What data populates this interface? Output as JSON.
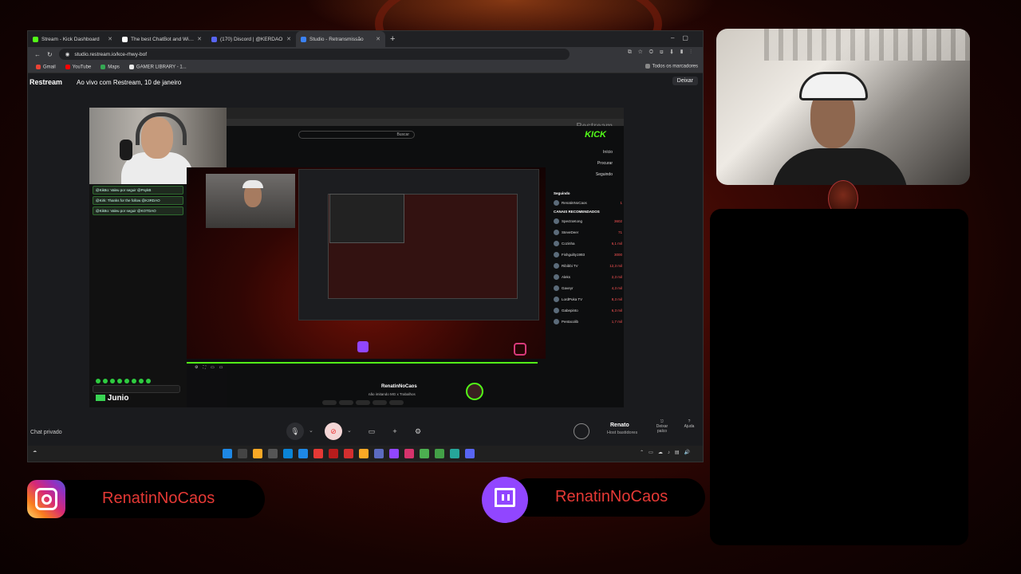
{
  "browser": {
    "tabs": [
      {
        "title": "Stream - Kick Dashboard",
        "color": "#53fc18",
        "active": false
      },
      {
        "title": "The best ChatBot and Widget",
        "color": "#ffffff",
        "active": false
      },
      {
        "title": "(170) Discord | @KERDAO",
        "color": "#5865f2",
        "active": false
      },
      {
        "title": "Studio - Retransmissão",
        "color": "#3b82f6",
        "active": true
      }
    ],
    "url": "studio.restream.io/kce-rhwy-bof",
    "bookmarks": [
      "Gmail",
      "YouTube",
      "Maps",
      "GAMER LIBRARY - 1..."
    ],
    "bookmarks_right": "Todos os marcadores"
  },
  "studio": {
    "logo": "Restream",
    "title": "Ao vivo com Restream, 10 de janeiro",
    "exit_label": "Deixar",
    "chat_private": "Chat privado",
    "user_name": "Renato",
    "user_sub": "Host bastidores",
    "leave_label": "Deixar palco",
    "help_label": "Ajuda"
  },
  "canvas": {
    "chat_lines": [
      "@Kik8o: Valeu por seguir @PsykB",
      "@Kirk: Thanks for the follow @K3RDAO",
      "@Kik8o: Valeu por seguir @KOTDAO"
    ],
    "chat_name": "Junio",
    "kick": {
      "search": "Buscar",
      "nav": [
        "Início",
        "Procurar",
        "Seguindo"
      ],
      "following_header": "Seguindo",
      "recommended_header": "CANAIS RECOMENDADOS",
      "channels": [
        {
          "name": "RenatinNoCaos",
          "count": "1"
        },
        {
          "name": "SpectraKong",
          "count": "3602"
        },
        {
          "name": "SteveDeer",
          "count": "71"
        },
        {
          "name": "Cozinha",
          "count": "6,1 mil"
        },
        {
          "name": "Fishguilty1993",
          "count": "3000"
        },
        {
          "name": "Ribibbi TV",
          "count": "12,3 mil"
        },
        {
          "name": "Aleks",
          "count": "2,3 mil"
        },
        {
          "name": "Gaveyr",
          "count": "4,3 mil"
        },
        {
          "name": "LordPuka TV",
          "count": "8,3 mil"
        },
        {
          "name": "Gabepinto",
          "count": "6,3 mil"
        },
        {
          "name": "Pentacolib",
          "count": "1,7 mil"
        }
      ],
      "streamer_name": "RenatinNoCaos",
      "stream_title": "não imitando MG x Trabalhos"
    }
  },
  "overlay": {
    "instagram_handle": "RenatinNoCaos",
    "twitch_handle": "RenatinNoCaos",
    "accent_red": "#e53935",
    "twitch_purple": "#9146ff",
    "kick_green": "#53fc18"
  }
}
